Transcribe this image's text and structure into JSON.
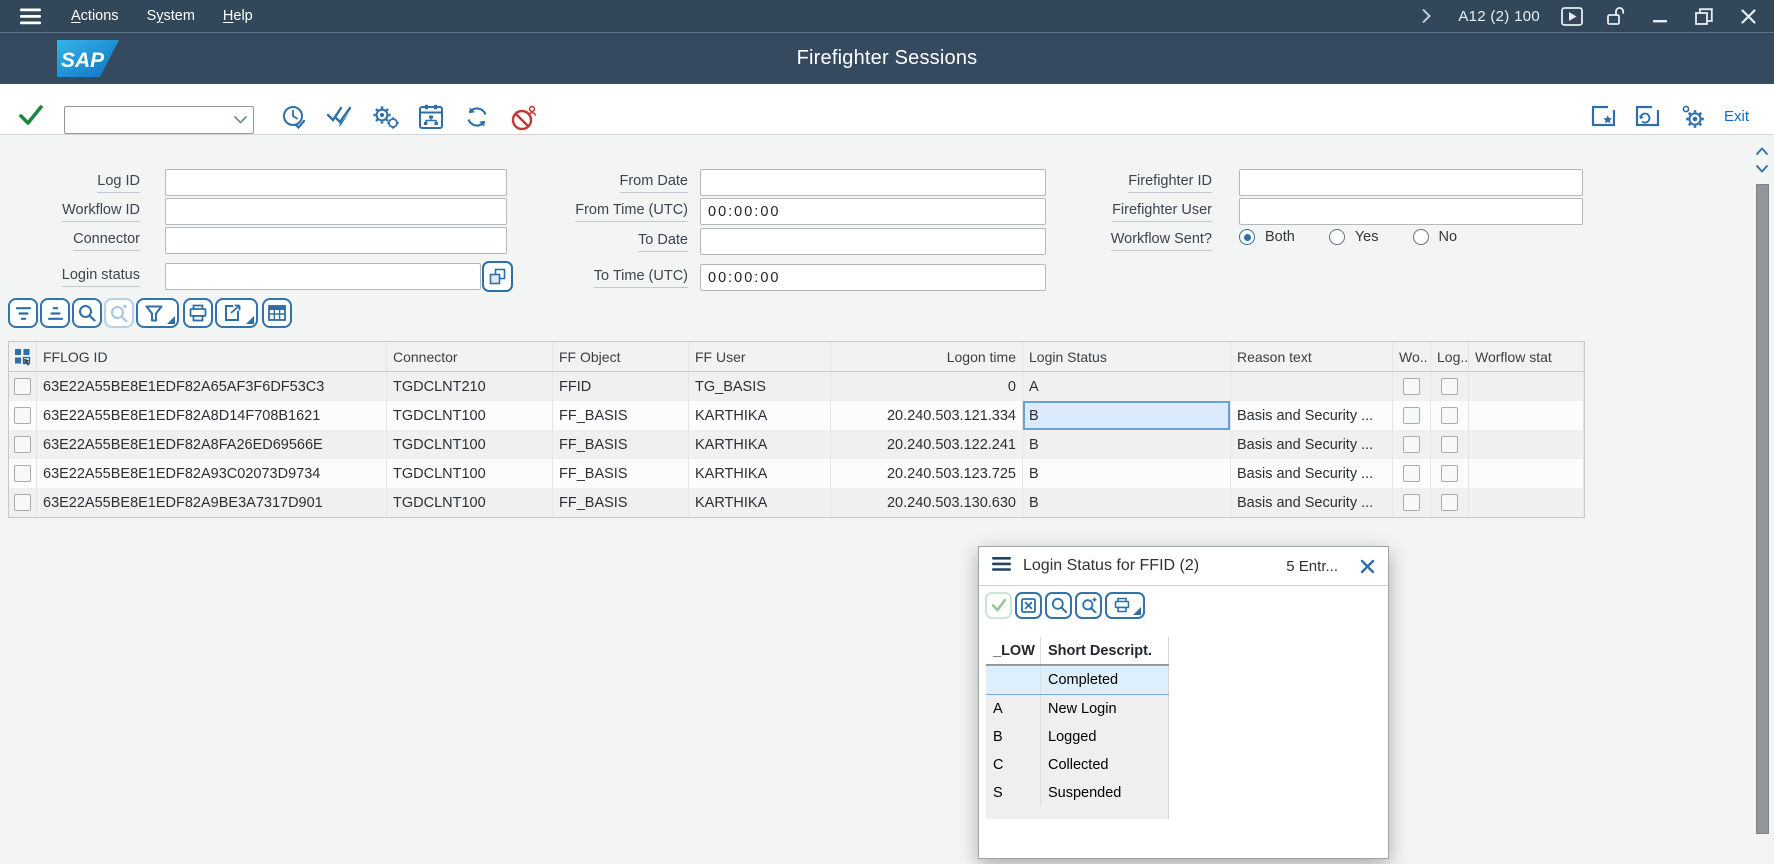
{
  "shell": {
    "menu": [
      {
        "pre": "",
        "u": "A",
        "post": "ctions"
      },
      {
        "pre": "S",
        "u": "y",
        "post": "stem"
      },
      {
        "pre": "",
        "u": "H",
        "post": "elp"
      }
    ],
    "system_id": "A12 (2) 100",
    "logo_text": "SAP",
    "title": "Firefighter Sessions"
  },
  "toolbar": {
    "command_value": "",
    "exit_label": "Exit"
  },
  "filters": {
    "log_id": {
      "label": "Log ID",
      "value": ""
    },
    "workflow_id": {
      "label": "Workflow ID",
      "value": ""
    },
    "connector": {
      "label": "Connector",
      "value": ""
    },
    "login_status": {
      "label": "Login status",
      "value": ""
    },
    "from_date": {
      "label": "From Date",
      "value": ""
    },
    "from_time": {
      "label": "From Time (UTC)",
      "value": "00:00:00"
    },
    "to_date": {
      "label": "To Date",
      "value": ""
    },
    "to_time": {
      "label": "To Time (UTC)",
      "value": "00:00:00"
    },
    "firefighter_id": {
      "label": "Firefighter ID",
      "value": ""
    },
    "firefighter_user": {
      "label": "Firefighter User",
      "value": ""
    },
    "workflow_sent": {
      "label": "Workflow Sent?",
      "options": [
        "Both",
        "Yes",
        "No"
      ],
      "selected": "Both"
    }
  },
  "grid": {
    "columns": {
      "fflog": "FFLOG ID",
      "connector": "Connector",
      "ff_object": "FF Object",
      "ff_user": "FF User",
      "logon_time": "Logon time",
      "login_status": "Login Status",
      "reason": "Reason text",
      "wo": "Wo..",
      "log": "Log..",
      "workflow_stat": "Worflow stat"
    },
    "rows": [
      {
        "id": "63E22A55BE8E1EDF82A65AF3F6DF53C3",
        "connector": "TGDCLNT210",
        "object": "FFID",
        "user": "TG_BASIS",
        "time": "0",
        "status": "A",
        "reason": ""
      },
      {
        "id": "63E22A55BE8E1EDF82A8D14F708B1621",
        "connector": "TGDCLNT100",
        "object": "FF_BASIS",
        "user": "KARTHIKA",
        "time": "20.240.503.121.334",
        "status": "B",
        "reason": "Basis and Security ..."
      },
      {
        "id": "63E22A55BE8E1EDF82A8FA26ED69566E",
        "connector": "TGDCLNT100",
        "object": "FF_BASIS",
        "user": "KARTHIKA",
        "time": "20.240.503.122.241",
        "status": "B",
        "reason": "Basis and Security ..."
      },
      {
        "id": "63E22A55BE8E1EDF82A93C02073D9734",
        "connector": "TGDCLNT100",
        "object": "FF_BASIS",
        "user": "KARTHIKA",
        "time": "20.240.503.123.725",
        "status": "B",
        "reason": "Basis and Security ..."
      },
      {
        "id": "63E22A55BE8E1EDF82A9BE3A7317D901",
        "connector": "TGDCLNT100",
        "object": "FF_BASIS",
        "user": "KARTHIKA",
        "time": "20.240.503.130.630",
        "status": "B",
        "reason": "Basis and Security ..."
      }
    ]
  },
  "popup": {
    "title": "Login Status for FFID (2)",
    "entries": "5 Entr...",
    "columns": {
      "low": "_LOW",
      "desc": "Short Descript."
    },
    "rows": [
      {
        "code": "",
        "desc": "Completed"
      },
      {
        "code": "A",
        "desc": "New Login"
      },
      {
        "code": "B",
        "desc": "Logged"
      },
      {
        "code": "C",
        "desc": "Collected"
      },
      {
        "code": "S",
        "desc": "Suspended"
      }
    ]
  },
  "colors": {
    "shell_bar": "#354a5f",
    "icon_blue": "#2f6fa8",
    "link_blue": "#0a6ed1",
    "check_green": "#1d883d",
    "alert_red": "#c23934",
    "selection_bg": "#dbeafc",
    "row_alt": "#f0f0f0"
  }
}
